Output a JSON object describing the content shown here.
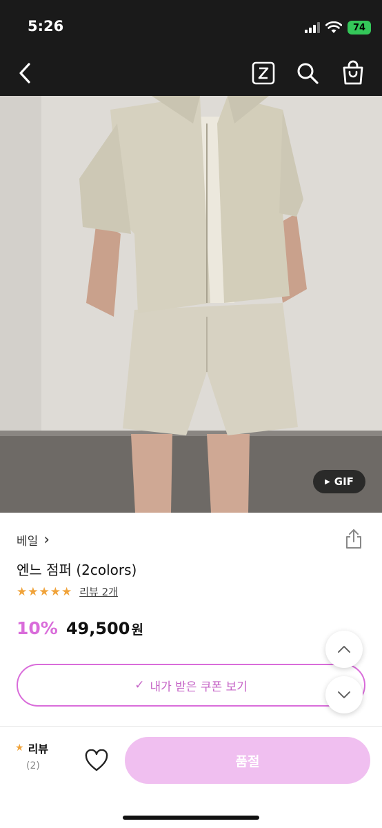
{
  "status_bar": {
    "time": "5:26",
    "battery": "74"
  },
  "nav": {
    "back_icon": "chevron-left-icon",
    "z_icon": "z-square-icon",
    "search_icon": "search-icon",
    "bag_icon": "shopping-bag-icon"
  },
  "hero": {
    "gif_label": "GIF",
    "play_glyph": "▶"
  },
  "product": {
    "brand": "베일",
    "brand_chevron": "›",
    "name": "엔느 점퍼 (2colors)",
    "stars": "★★★★★",
    "review_link": "리뷰 2개",
    "discount": "10%",
    "price": "49,500",
    "price_unit": "원"
  },
  "coupon": {
    "check": "✓",
    "label": "내가 받은 쿠폰 보기"
  },
  "bottom_bar": {
    "review_star": "★",
    "review_label": "리뷰",
    "review_count": "(2)",
    "buy_label": "품절"
  },
  "colors": {
    "accent": "#d96cda",
    "sold_out_button": "#f0bff0",
    "star": "#f0a33a",
    "top_bar": "#1a1a1a"
  }
}
